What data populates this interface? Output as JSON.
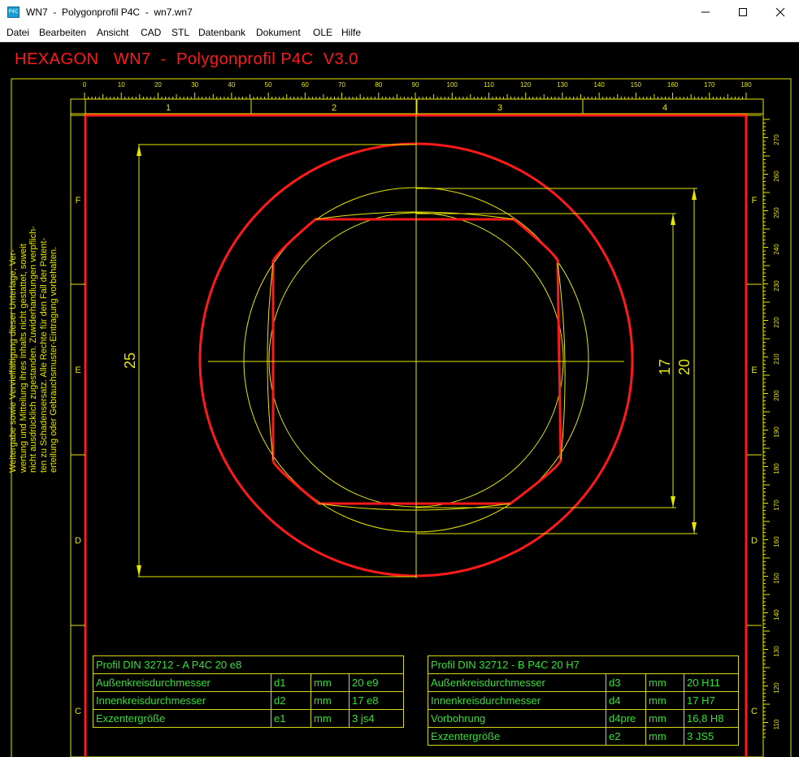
{
  "window": {
    "title": "WN7  -  Polygonprofil P4C  -  wn7.wn7",
    "icon_label": "P4C",
    "controls": [
      "minimize-icon",
      "maximize-icon",
      "close-icon"
    ]
  },
  "menu": [
    "Datei",
    "Bearbeiten",
    "Ansicht",
    "CAD",
    "STL",
    "Datenbank",
    "Dokument",
    "OLE",
    "Hilfe"
  ],
  "header": {
    "title": "HEXAGON   WN7  -  Polygonprofil P4C  V3.0"
  },
  "colors": {
    "canvas_bg": "#000000",
    "frame": "#ff1a1a",
    "construction": "#e6e600",
    "table_text": "#35e035"
  },
  "ruler_top": {
    "labels": [
      "0",
      "10",
      "20",
      "30",
      "40",
      "50",
      "60",
      "70",
      "80",
      "90",
      "100",
      "110",
      "120",
      "130",
      "140",
      "150",
      "160",
      "170",
      "180"
    ]
  },
  "ruler_right": {
    "labels": [
      "270",
      "260",
      "250",
      "240",
      "230",
      "220",
      "210",
      "200",
      "190",
      "180",
      "170",
      "160",
      "150",
      "140",
      "130",
      "120",
      "110"
    ]
  },
  "zones_columns": [
    "1",
    "2",
    "3",
    "4"
  ],
  "zones_rows": [
    "F",
    "E",
    "D",
    "C"
  ],
  "dimensions": {
    "outer": "25",
    "inner_a": "17",
    "inner_b": "20"
  },
  "notice_lines": [
    "Weitergabe sowie Vervielfältigung dieser Unterlage, Ver-",
    "wertung und Mitteilung ihres Inhalts nicht gestattet, soweit",
    "nicht ausdrücklich zugestanden. Zuwiderhandlungen verpflich-",
    "ten zu Schadensersatz. Alle Rechte für den Fall der Patent-",
    "erteilung oder Gebrauchsmuster-Eintragung vorbehalten."
  ],
  "table_a": {
    "title": "Profil DIN 32712 - A P4C 20 e8",
    "rows": [
      [
        "Außenkreisdurchmesser",
        "d1",
        "mm",
        "20 e9"
      ],
      [
        "Innenkreisdurchmesser",
        "d2",
        "mm",
        "17 e8"
      ],
      [
        "Exzentergröße",
        "e1",
        "mm",
        "3 js4"
      ]
    ]
  },
  "table_b": {
    "title": "Profil DIN 32712 - B P4C 20 H7",
    "rows": [
      [
        "Außenkreisdurchmesser",
        "d3",
        "mm",
        "20 H11"
      ],
      [
        "Innenkreisdurchmesser",
        "d4",
        "mm",
        "17 H7"
      ],
      [
        "Vorbohrung",
        "d4pre",
        "mm",
        "16,8 H8"
      ],
      [
        "Exzentergröße",
        "e2",
        "mm",
        "3 JS5"
      ]
    ]
  }
}
